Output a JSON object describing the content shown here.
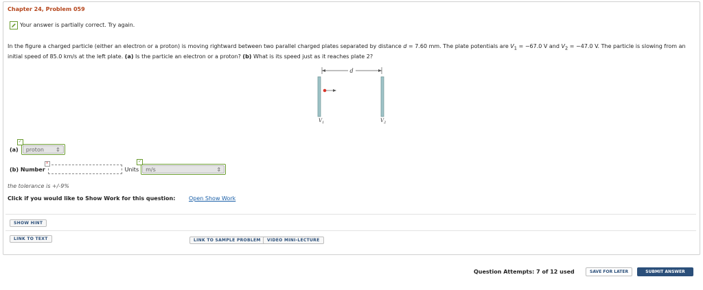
{
  "header": {
    "title": "Chapter 24, Problem 059"
  },
  "status": {
    "message": "Your answer is partially correct.  Try again."
  },
  "problem": {
    "text1": "In the figure a charged particle (either an electron or a proton) is moving rightward between two parallel charged plates separated by distance ",
    "d_symbol": "d",
    "text2": " = 7.60 mm. The plate potentials are ",
    "v1_symbol": "V",
    "v1_sub": "1",
    "text3": " = −67.0 V and ",
    "v2_symbol": "V",
    "v2_sub": "2",
    "text4": " = −47.0 V. The particle is slowing from an initial speed of 85.0 km/s at the left plate. ",
    "part_a_label": "(a)",
    "text5": " Is the particle an electron or a proton? ",
    "part_b_label": "(b)",
    "text6": " What is its speed just as it reaches plate 2?"
  },
  "figure": {
    "d_label": "d",
    "v1_label": "V",
    "v1_sub": "1",
    "v2_label": "V",
    "v2_sub": "2"
  },
  "answer_a": {
    "label": "(a)",
    "selected": "proton"
  },
  "answer_b": {
    "label": "(b) Number",
    "value": "",
    "units_label": "Units",
    "units_selected": "m/s"
  },
  "tolerance": "the tolerance is +/-9%",
  "show_work": {
    "prompt": "Click if you would like to Show Work for this question:",
    "link": "Open Show Work"
  },
  "buttons": {
    "show_hint": "SHOW HINT",
    "link_to_text": "LINK TO TEXT",
    "sample_problem": "LINK TO SAMPLE PROBLEM",
    "mini_lecture": "VIDEO MINI-LECTURE",
    "save_later": "SAVE FOR LATER",
    "submit": "SUBMIT ANSWER"
  },
  "attempts": "Question Attempts: 7 of 12 used",
  "colors": {
    "title": "#b5451b",
    "accent_green": "#6a9b2f",
    "link": "#1a5fa8",
    "submit_bg": "#2b4f7a",
    "plate": "#9fc4c8",
    "particle": "#d9362b"
  }
}
